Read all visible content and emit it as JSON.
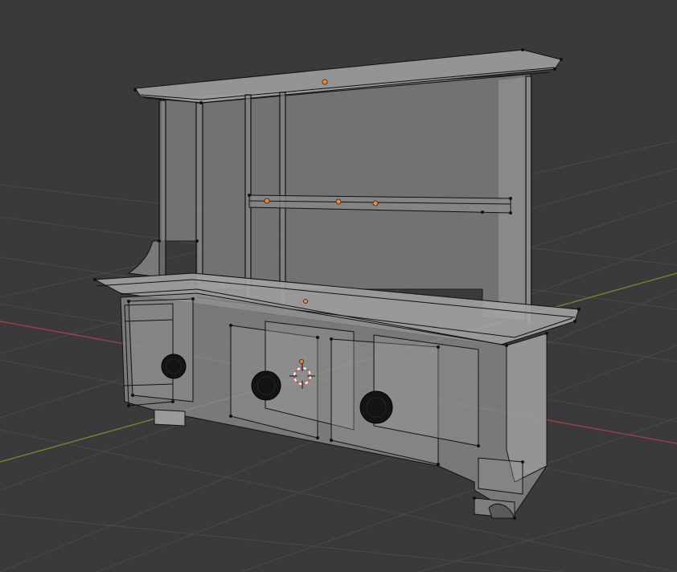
{
  "viewport": {
    "background": "#3a3a3a",
    "grid_color": "#474747",
    "x_axis_color": "#9a3f48",
    "y_axis_color": "#6b8a2e",
    "wire_color": "#111111",
    "mesh_fill": "#8c8c8c",
    "origin_color": "#f08a3a",
    "cursor_colors": [
      "#e04a4a",
      "#ffffff"
    ],
    "knob_color": "#141414"
  },
  "scene": {
    "object": "dresser-mesh",
    "view_mode": "x-ray",
    "shading": "solid-transparent"
  }
}
